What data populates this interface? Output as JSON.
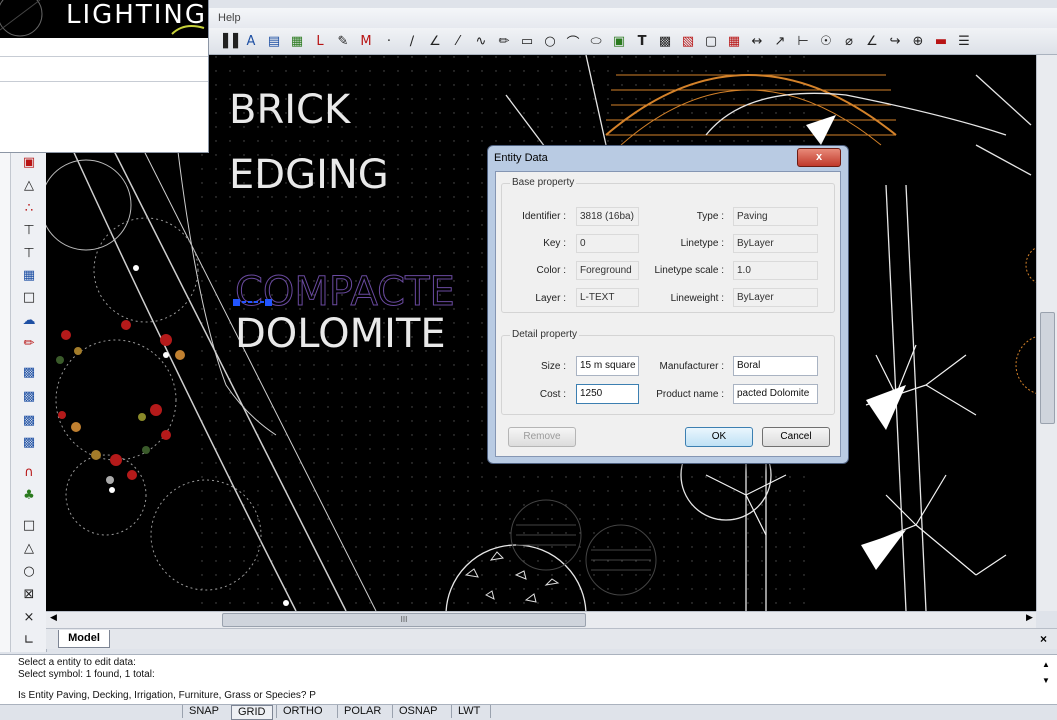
{
  "overlay_window": {
    "logo_text": "LIGHTING"
  },
  "menu": {
    "help_label": "Help"
  },
  "toolbar_icons": [
    "bar-chart-icon",
    "text-style-icon",
    "dimension-icon",
    "layer-icon",
    "layout-icon",
    "pen-icon",
    "property-icon",
    "point-icon",
    "line-icon",
    "polyline-icon",
    "construction-line-icon",
    "spline-icon",
    "pencil-icon",
    "rectangle-icon",
    "circle-icon",
    "arc-icon",
    "ellipse-icon",
    "image-icon",
    "text-icon",
    "block-icon",
    "insert-icon",
    "region-icon",
    "hatch-icon",
    "dim-linear-icon",
    "dim-aligned-icon",
    "dim-ordinate-icon",
    "dim-radius-icon",
    "dim-diameter-icon",
    "dim-angular-icon",
    "leader-icon",
    "center-mark-icon",
    "layer-red-icon",
    "layer-manager-icon"
  ],
  "canvas": {
    "labels": {
      "brick": "BRICK",
      "edging": "EDGING",
      "compacted": "COMPACTE",
      "dolomite": "DOLOMITE"
    },
    "colors": {
      "background": "#000000",
      "hatch": "#d4822a",
      "selected": "#5a3a8a",
      "grip": "#2255ff"
    }
  },
  "scroll": {
    "h_thumb_label": "III"
  },
  "tabs": {
    "model_label": "Model",
    "close_label": "×"
  },
  "dialog": {
    "title": "Entity Data",
    "close_label": "x",
    "base_group_label": "Base property",
    "base": {
      "identifier_label": "Identifier :",
      "identifier_value": "3818 (16ba)",
      "type_label": "Type :",
      "type_value": "Paving",
      "key_label": "Key :",
      "key_value": "0",
      "linetype_label": "Linetype :",
      "linetype_value": "ByLayer",
      "color_label": "Color :",
      "color_value": "Foreground",
      "linetype_scale_label": "Linetype scale :",
      "linetype_scale_value": "1.0",
      "layer_label": "Layer :",
      "layer_value": "L-TEXT",
      "lineweight_label": "Lineweight :",
      "lineweight_value": "ByLayer"
    },
    "detail_group_label": "Detail property",
    "detail": {
      "size_label": "Size :",
      "size_value": "15 m square",
      "manufacturer_label": "Manufacturer :",
      "manufacturer_value": "Boral",
      "cost_label": "Cost :",
      "cost_value": "1250",
      "product_name_label": "Product name :",
      "product_name_value": "pacted Dolomite"
    },
    "remove_label": "Remove",
    "ok_label": "OK",
    "cancel_label": "Cancel"
  },
  "command": {
    "line1": "Select a entity to edit data:",
    "line2": "Select symbol: 1 found, 1 total:",
    "line3": "Is Entity Paving, Decking, Irrigation, Furniture, Grass or Species? P"
  },
  "status": {
    "snap": "SNAP",
    "grid": "GRID",
    "ortho": "ORTHO",
    "polar": "POLAR",
    "osnap": "OSNAP",
    "lwt": "LWT"
  }
}
